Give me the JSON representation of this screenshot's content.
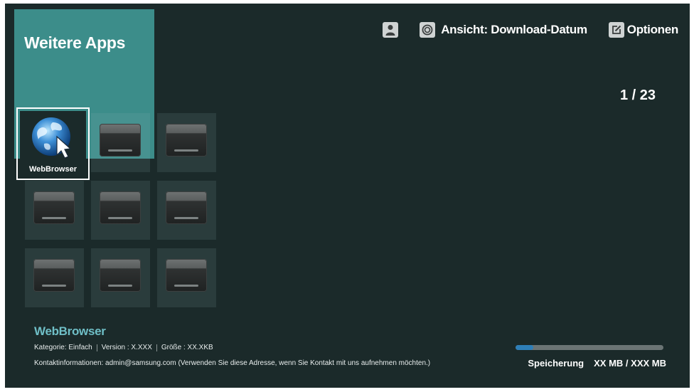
{
  "screen": {
    "title": "Weitere Apps",
    "page_indicator": "1 / 23"
  },
  "topbar": {
    "account_icon": "user-icon",
    "view_icon": "view-icon",
    "view_label": "Ansicht: Download-Datum",
    "options_icon": "edit-icon",
    "options_label": "Optionen"
  },
  "grid": {
    "selected_app": {
      "name": "WebBrowser",
      "icon": "globe-cursor-icon"
    },
    "empty_slots": 8
  },
  "info": {
    "app_name": "WebBrowser",
    "category": "Kategorie: Einfach",
    "version": "Version : X.XXX",
    "size": "Größe : XX.XKB",
    "contact": "Kontaktinformationen: admin@samsung.com (Verwenden Sie diese Adresse, wenn Sie Kontakt mit uns aufnehmen möchten.)"
  },
  "storage": {
    "label": "Speicherung",
    "value": "XX MB / XXX  MB",
    "used_fraction": 0.12
  },
  "colors": {
    "background": "#1b2a2a",
    "title_panel": "#3c8d8a",
    "accent_text": "#6fbfc7",
    "storage_fill": "#2e7fb8"
  }
}
